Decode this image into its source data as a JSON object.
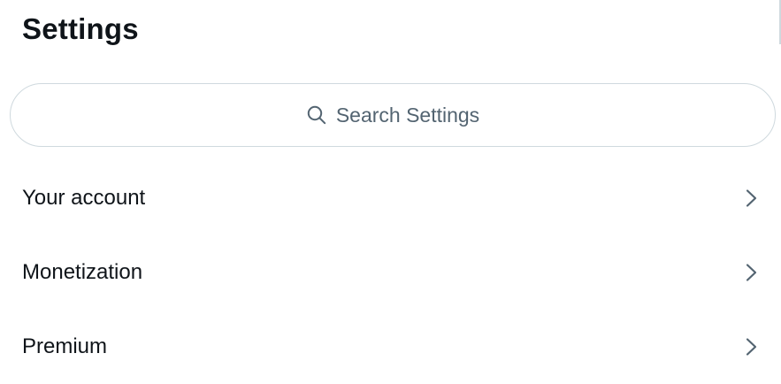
{
  "header": {
    "title": "Settings"
  },
  "search": {
    "placeholder": "Search Settings",
    "icon": "search-icon"
  },
  "menu": {
    "items": [
      {
        "label": "Your account",
        "icon": "chevron-right-icon"
      },
      {
        "label": "Monetization",
        "icon": "chevron-right-icon"
      },
      {
        "label": "Premium",
        "icon": "chevron-right-icon"
      }
    ]
  },
  "colors": {
    "text_primary": "#0f1419",
    "text_secondary": "#536471",
    "border": "#cfd9de",
    "background": "#ffffff"
  }
}
